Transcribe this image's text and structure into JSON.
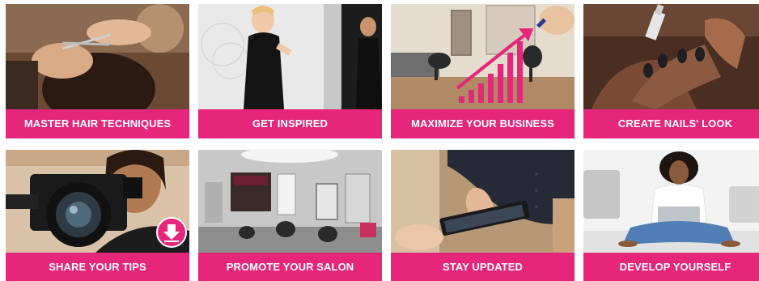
{
  "accent_color": "#e5267b",
  "tiles": [
    {
      "label": "MASTER HAIR TECHNIQUES",
      "image": "hairdresser-cutting-hair-photo"
    },
    {
      "label": "GET INSPIRED",
      "image": "fashion-model-photo"
    },
    {
      "label": "MAXIMIZE YOUR BUSINESS",
      "image": "salon-growth-chart-photo"
    },
    {
      "label": "CREATE NAILS' LOOK",
      "image": "nail-painting-photo"
    },
    {
      "label": "SHARE YOUR TIPS",
      "image": "woman-with-video-camera-photo"
    },
    {
      "label": "PROMOTE YOUR SALON",
      "image": "salon-interior-photo"
    },
    {
      "label": "STAY UPDATED",
      "image": "tablet-in-hands-photo"
    },
    {
      "label": "DEVELOP YOURSELF",
      "image": "woman-with-laptop-photo"
    }
  ],
  "icons": {
    "download": "download-arrow-icon"
  }
}
